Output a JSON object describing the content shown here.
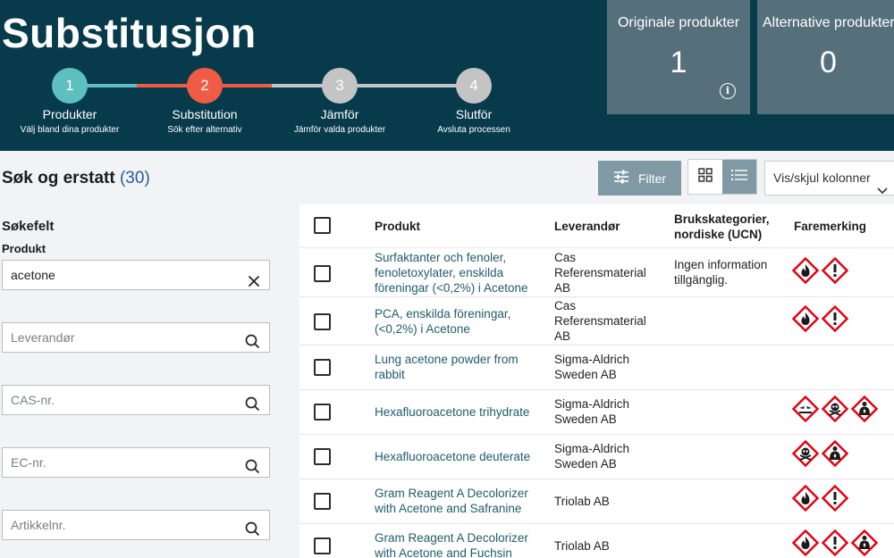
{
  "header": {
    "title": "Substitusjon",
    "steps": [
      {
        "number": "1",
        "label": "Produkter",
        "sub": "Välj bland dina produkter",
        "color": "#5fbfbf"
      },
      {
        "number": "2",
        "label": "Substitution",
        "sub": "Sök efter alternativ",
        "color": "#ef5b45"
      },
      {
        "number": "3",
        "label": "Jämför",
        "sub": "Jämför valda produkter",
        "color": "#c4c4c4"
      },
      {
        "number": "4",
        "label": "Slutför",
        "sub": "Avsluta processen",
        "color": "#c4c4c4"
      }
    ],
    "counters": [
      {
        "title": "Originale produkter",
        "value": "1"
      },
      {
        "title": "Alternative produkter",
        "value": "0"
      }
    ]
  },
  "toolbar": {
    "results_title": "Søk og erstatt",
    "results_count": "(30)",
    "filter_label": "Filter",
    "columns_label": "Vis/skjul kolonner"
  },
  "sidebar": {
    "title": "Søkefelt",
    "product_label": "Produkt",
    "product_value": "acetone",
    "fields": [
      {
        "placeholder": "Leverandør"
      },
      {
        "placeholder": "CAS-nr."
      },
      {
        "placeholder": "EC-nr."
      },
      {
        "placeholder": "Artikkelnr."
      }
    ]
  },
  "table": {
    "headers": {
      "product": "Produkt",
      "supplier": "Leverandør",
      "ucn": "Brukskategorier, nordiske (UCN)",
      "hazard": "Faremerking"
    },
    "rows": [
      {
        "product": "Surfaktanter och fenoler, fenoletoxylater, enskilda föreningar (<0,2%) i Acetone",
        "supplier": "Cas Referensmaterial AB",
        "ucn": "Ingen information tillgänglig.",
        "hazards": [
          "flame-icon",
          "exclamation-icon"
        ]
      },
      {
        "product": "PCA, enskilda föreningar, (<0,2%) i Acetone",
        "supplier": "Cas Referensmaterial AB",
        "ucn": "",
        "hazards": [
          "flame-icon",
          "exclamation-icon"
        ]
      },
      {
        "product": "Lung acetone powder from rabbit",
        "supplier": "Sigma-Aldrich Sweden AB",
        "ucn": "",
        "hazards": []
      },
      {
        "product": "Hexafluoroacetone trihydrate",
        "supplier": "Sigma-Aldrich Sweden AB",
        "ucn": "",
        "hazards": [
          "corrosion-icon",
          "skull-icon",
          "health-hazard-icon"
        ]
      },
      {
        "product": "Hexafluoroacetone deuterate",
        "supplier": "Sigma-Aldrich Sweden AB",
        "ucn": "",
        "hazards": [
          "skull-icon",
          "health-hazard-icon"
        ]
      },
      {
        "product": "Gram Reagent A Decolorizer with Acetone and Safranine",
        "supplier": "Triolab AB",
        "ucn": "",
        "hazards": [
          "flame-icon",
          "exclamation-icon"
        ]
      },
      {
        "product": "Gram Reagent A Decolorizer with Acetone and Fuchsin",
        "supplier": "Triolab AB",
        "ucn": "",
        "hazards": [
          "flame-icon",
          "exclamation-icon",
          "health-hazard-icon"
        ]
      }
    ]
  },
  "colors": {
    "header_bg": "#073b4c",
    "counter_bg": "#55707b",
    "accent": "#7f9aa5",
    "link": "#1f5c6b",
    "ghs_red": "#e3000f"
  }
}
